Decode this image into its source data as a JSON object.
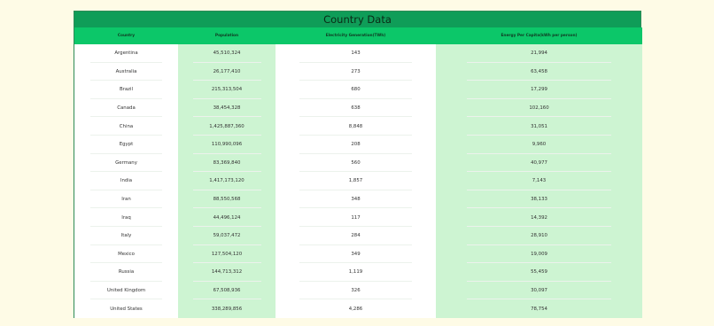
{
  "table": {
    "title": "Country Data",
    "headers": [
      "Country",
      "Population",
      "Electricity Generation(TWh)",
      "Energy Per Capita(kWh per person)"
    ],
    "rows": [
      [
        "Argentina",
        "45,510,324",
        "143",
        "21,994"
      ],
      [
        "Australia",
        "26,177,410",
        "273",
        "63,458"
      ],
      [
        "Brazil",
        "215,313,504",
        "680",
        "17,299"
      ],
      [
        "Canada",
        "38,454,328",
        "638",
        "102,160"
      ],
      [
        "China",
        "1,425,887,360",
        "8,848",
        "31,051"
      ],
      [
        "Egypt",
        "110,990,096",
        "208",
        "9,960"
      ],
      [
        "Germany",
        "83,369,840",
        "560",
        "40,977"
      ],
      [
        "India",
        "1,417,173,120",
        "1,857",
        "7,143"
      ],
      [
        "Iran",
        "88,550,568",
        "348",
        "38,133"
      ],
      [
        "Iraq",
        "44,496,124",
        "117",
        "14,392"
      ],
      [
        "Italy",
        "59,037,472",
        "284",
        "28,910"
      ],
      [
        "Mexico",
        "127,504,120",
        "349",
        "19,009"
      ],
      [
        "Russia",
        "144,713,312",
        "1,119",
        "55,459"
      ],
      [
        "United Kingdom",
        "67,508,936",
        "326",
        "30,097"
      ],
      [
        "United States",
        "338,289,856",
        "4,286",
        "78,754"
      ]
    ]
  },
  "colors": {
    "title_bg": "#0f9d58",
    "header_bg": "#0cc769",
    "shade": "#cdf4d2",
    "page_bg": "#fefbe6"
  }
}
